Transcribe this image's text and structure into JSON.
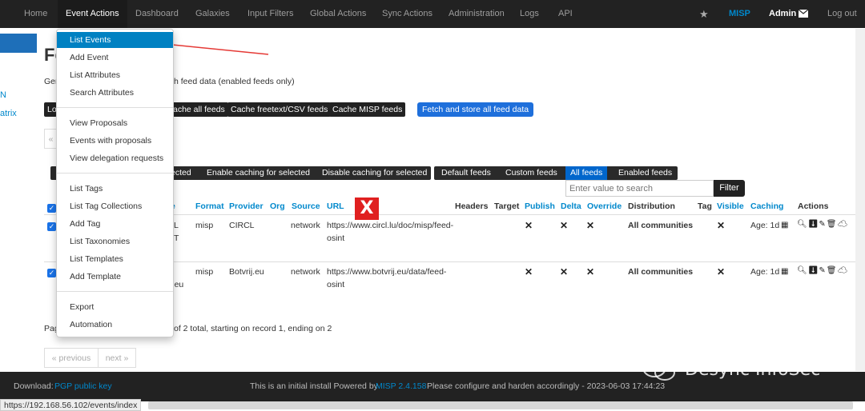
{
  "nav": {
    "items": [
      "Home",
      "Event Actions",
      "Dashboard",
      "Galaxies",
      "Input Filters",
      "Global Actions",
      "Sync Actions",
      "Administration",
      "Logs",
      "API"
    ],
    "brand": "MISP",
    "user": "Admin",
    "logout": "Log out"
  },
  "side": {
    "link1": "N",
    "link2": "atrix"
  },
  "page": {
    "title": "Fe",
    "desc_left": "Ger",
    "desc_right": "h feed data (enabled feeds only)"
  },
  "actions": {
    "load": "Lo",
    "cache_all": "ache all feeds",
    "cache_freetext": "Cache freetext/CSV feeds",
    "cache_misp": "Cache MISP feeds",
    "fetch_store": "Fetch and store all feed data"
  },
  "bulk": {
    "selected": "ected",
    "enable_caching": "Enable caching for selected",
    "disable_caching": "Disable caching for selected"
  },
  "filters": {
    "default": "Default feeds",
    "custom": "Custom feeds",
    "all": "All feeds",
    "enabled": "Enabled feeds"
  },
  "search": {
    "placeholder": "Enter value to search",
    "button": "Filter"
  },
  "table": {
    "headers": {
      "name_frag": "e",
      "format": "Format",
      "provider": "Provider",
      "org": "Org",
      "source": "Source",
      "url": "URL",
      "headers": "Headers",
      "target": "Target",
      "publish": "Publish",
      "delta": "Delta",
      "override": "Override",
      "distribution": "Distribution",
      "tag": "Tag",
      "visible": "Visible",
      "caching": "Caching",
      "actions": "Actions"
    },
    "rows": [
      {
        "name_frag1": "L",
        "name_frag2": "T",
        "format": "misp",
        "provider": "CIRCL",
        "source": "network",
        "url1": "https://www.circl.lu/doc/misp/feed-",
        "url2": "osint",
        "distribution": "All communities",
        "caching": "Age: 1d"
      },
      {
        "name_frag1": "",
        "name_frag2": "ij.eu",
        "format": "misp",
        "provider": "Botvrij.eu",
        "source": "network",
        "url1": "https://www.botvrij.eu/data/feed-",
        "url2": "osint",
        "distribution": "All communities",
        "caching": "Age: 1d"
      }
    ]
  },
  "paging": {
    "left": "Pag",
    "right": "of 2 total, starting on record 1, ending on 2",
    "previous": "« previous",
    "next": "next »",
    "prev_top": "«"
  },
  "menu": {
    "items": [
      "List Events",
      "Add Event",
      "List Attributes",
      "Search Attributes",
      "View Proposals",
      "Events with proposals",
      "View delegation requests",
      "List Tags",
      "List Tag Collections",
      "Add Tag",
      "List Taxonomies",
      "List Templates",
      "Add Template",
      "Export",
      "Automation"
    ]
  },
  "footer": {
    "download": "Download:",
    "pgp": "PGP public key",
    "install": "This is an initial install Powered by",
    "version": "MISP 2.4.158",
    "note": "Please configure and harden accordingly - 2023-06-03 17:44:23"
  },
  "status_url": "https://192.168.56.102/events/index",
  "watermark": "Desync InfoSec",
  "colors": {
    "nav_bg": "#222222",
    "accent": "#0088cc",
    "menu_active": "#0081c2",
    "badge_red": "#e02020",
    "annotation_arrow": "#e53935"
  }
}
